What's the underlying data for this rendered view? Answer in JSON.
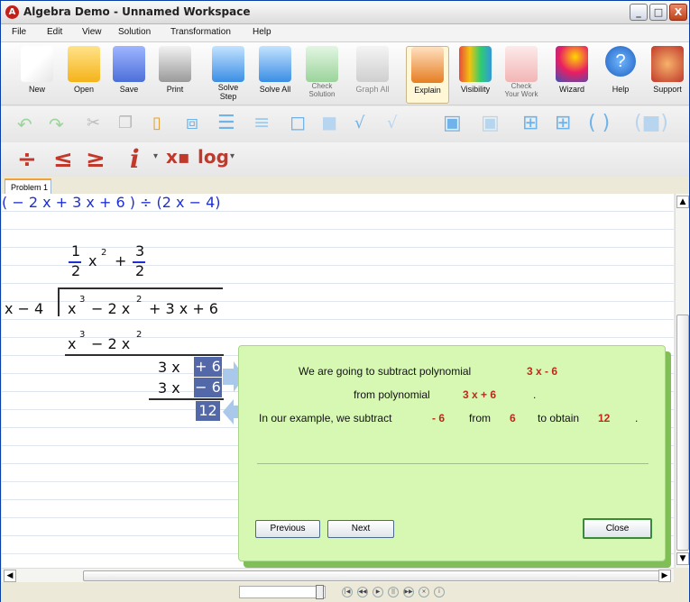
{
  "window": {
    "title": "Algebra Demo - Unnamed Workspace",
    "min": "_",
    "max": "□",
    "close": "X"
  },
  "menu": [
    "File",
    "Edit",
    "View",
    "Solution",
    "Transformation",
    "Help"
  ],
  "toolbar": {
    "new": "New",
    "open": "Open",
    "save": "Save",
    "print": "Print",
    "solve_step_1": "Solve",
    "solve_step_2": "Step",
    "solve_all": "Solve All",
    "check_solution_1": "Check",
    "check_solution_2": "Solution",
    "graph_all": "Graph All",
    "explain": "Explain",
    "visibility": "Visibility",
    "check_work_1": "Check",
    "check_work_2": "Your Work",
    "wizard": "Wizard",
    "help": "Help",
    "support": "Support"
  },
  "tabs": [
    "Problem 1"
  ],
  "math": {
    "header_line": "( − 2 x  + 3 x + 6 ) ÷ (2 x − 4)",
    "quotient": {
      "n1": "1",
      "d1": "2",
      "x": "x",
      "e": "2",
      "plus": "+",
      "n2": "3",
      "d2": "2"
    },
    "divisor": "x − 4",
    "dividend": {
      "t1": "x",
      "e1": "3",
      "t2": "− 2 x",
      "e2": "2",
      "t3": "+ 3 x + 6"
    },
    "sub_row": {
      "t1": "x",
      "e1": "3",
      "t2": "− 2 x",
      "e2": "2"
    },
    "row_a": {
      "left": "3 x",
      "box": "+ 6"
    },
    "row_b": {
      "left": "3 x",
      "box": "− 6"
    },
    "result": "12"
  },
  "explain": {
    "line1_pre": "We are going to subtract polynomial",
    "line1_val": "3 x - 6",
    "line2_pre": "from polynomial",
    "line2_val": "3 x + 6",
    "line2_post": ".",
    "line3_pre": "In our example, we subtract",
    "line3_v1": "- 6",
    "line3_mid1": "from",
    "line3_v2": "6",
    "line3_mid2": "to obtain",
    "line3_v3": "12",
    "line3_post": ".",
    "previous": "Previous",
    "next": "Next",
    "close": "Close"
  },
  "colors": {
    "accent_red": "#c0281c",
    "panel_bg": "#d6f8b3",
    "math_blue": "#2030d0",
    "box_blue": "#5268a8"
  }
}
